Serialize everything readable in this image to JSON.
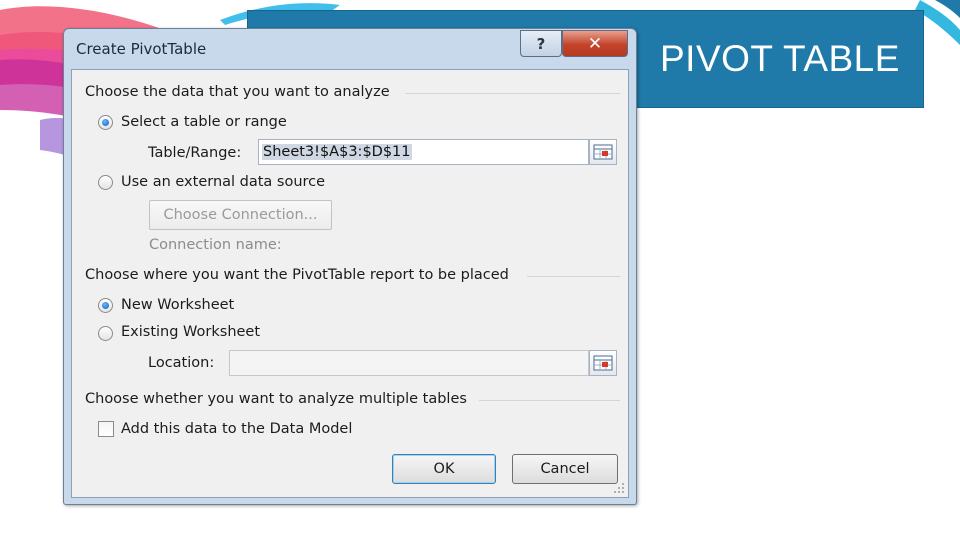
{
  "slide": {
    "title": "PIVOT TABLE",
    "banner_color": "#1f7aa9"
  },
  "dialog": {
    "title": "Create PivotTable",
    "help_icon": "question-mark-icon",
    "close_icon": "close-x-icon",
    "section_data": "Choose the data that you want to analyze",
    "option_table_range": "Select a table or range",
    "table_range_label": "Table/Range:",
    "table_range_value": "Sheet3!$A$3:$D$11",
    "option_external": "Use an external data source",
    "choose_connection_label": "Choose Connection...",
    "connection_name_label": "Connection name:",
    "section_placement": "Choose where you want the PivotTable report to be placed",
    "option_new_worksheet": "New Worksheet",
    "option_existing_worksheet": "Existing Worksheet",
    "location_label": "Location:",
    "location_value": "",
    "section_multiple": "Choose whether you want to analyze multiple tables",
    "add_data_model_label": "Add this data to the Data Model",
    "add_data_model_checked": false,
    "ok_label": "OK",
    "cancel_label": "Cancel",
    "selected_source": "table_range",
    "selected_placement": "new_worksheet",
    "accent_color": "#0d5fb8"
  }
}
